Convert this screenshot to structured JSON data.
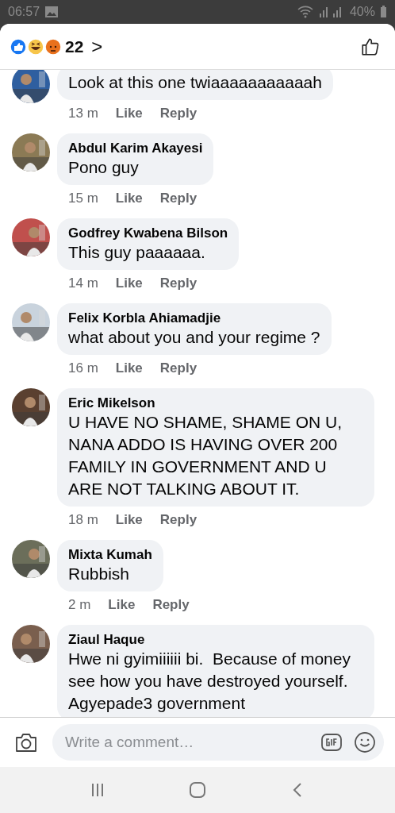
{
  "status_bar": {
    "time": "06:57",
    "battery": "40%"
  },
  "header": {
    "reaction_count": "22",
    "chevron": ">"
  },
  "comments": [
    {
      "text": "Look at this one twiaaaaaaaaaaah",
      "time": "13 m",
      "like": "Like",
      "reply": "Reply"
    },
    {
      "name": "Abdul Karim Akayesi",
      "text": "Pono guy",
      "time": "15 m",
      "like": "Like",
      "reply": "Reply"
    },
    {
      "name": "Godfrey Kwabena Bilson",
      "text": "This guy paaaaaa.",
      "time": "14 m",
      "like": "Like",
      "reply": "Reply"
    },
    {
      "name": "Felix Korbla Ahiamadjie",
      "text": "what about you and your regime ?",
      "time": "16 m",
      "like": "Like",
      "reply": "Reply"
    },
    {
      "name": "Eric Mikelson",
      "text": "U HAVE NO SHAME, SHAME ON U, NANA ADDO IS HAVING OVER 200 FAMILY IN GOVERNMENT AND U ARE NOT TALKING ABOUT IT.",
      "time": "18 m",
      "like": "Like",
      "reply": "Reply"
    },
    {
      "name": "Mixta Kumah",
      "text": "Rubbish",
      "time": "2 m",
      "like": "Like",
      "reply": "Reply"
    },
    {
      "name": "Ziaul Haque",
      "text": "Hwe ni gyimiiiiii bi.  Because of money see how you have destroyed yourself. Agyepade3 government"
    }
  ],
  "composer": {
    "placeholder": "Write a comment…"
  }
}
